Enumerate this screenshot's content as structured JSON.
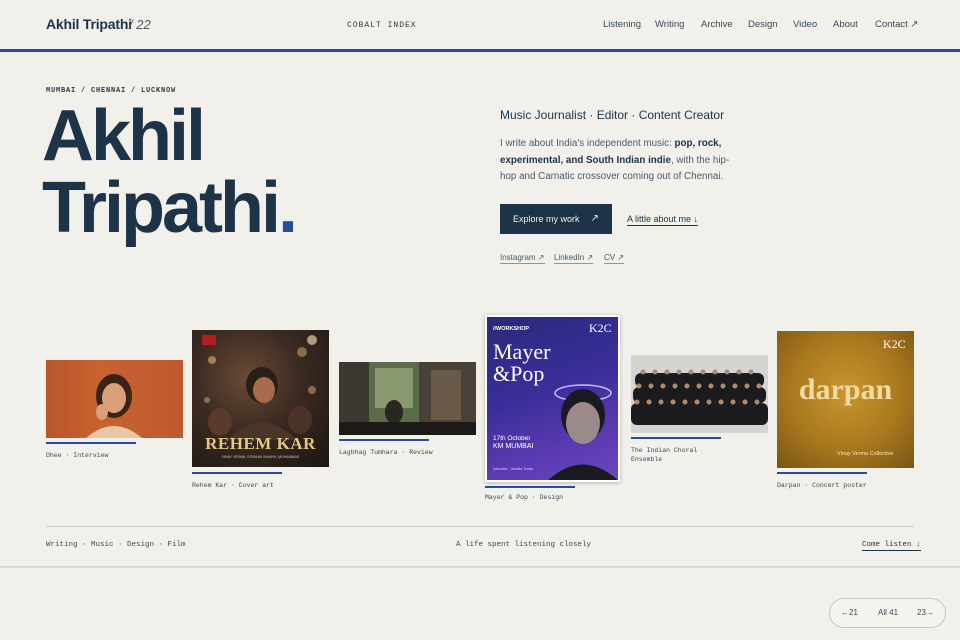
{
  "header": {
    "brand": "Akhil Tripathi",
    "brand_number": "/ 22",
    "site_name": "COBALT INDEX",
    "nav": [
      "Listening",
      "Writing",
      "Archive",
      "Design",
      "Video",
      "About",
      "Contact ↗"
    ]
  },
  "hero": {
    "locations": "MUMBAI / CHENNAI / LUCKNOW",
    "name_line1": "Akhil",
    "name_line2": "Tripathi",
    "name_dot": ".",
    "role": "Music Journalist · Editor · Content Creator",
    "bio_pre": "I write about India's independent music: ",
    "bio_bold": "pop, rock, experimental, and South Indian indie",
    "bio_post": ", with the hip-hop and Carnatic crossover coming out of Chennai.",
    "explore_label": "Explore my work",
    "explore_arrow": "↗",
    "about_label": "A little about me ↓",
    "social": [
      "Instagram ↗",
      "LinkedIn ↗",
      "CV ↗"
    ]
  },
  "gallery": [
    {
      "caption": "Dhee · Interview"
    },
    {
      "caption": "Rehem Kar · Cover art",
      "poster_text": "REHEM KAR",
      "poster_sub": "VINAY VERMA, ROSHAN SHAIKH, MOHAMMAD"
    },
    {
      "caption": "Lagbhag Tumhara · Review"
    },
    {
      "caption": "Mayer & Pop · Design",
      "tag": "//WORKSHOP",
      "logo": "K2C",
      "title": "Mayer &Pop",
      "date": "17th October",
      "place": "KM MUMBAI",
      "note": "Instructor - Vandita Tomar"
    },
    {
      "caption_line1": "The Indian Choral",
      "caption_line2": "Ensemble"
    },
    {
      "caption": "Darpan · Concert poster",
      "logo": "K2C",
      "title": "darpan",
      "sub": "Vinay Verma Collective"
    }
  ],
  "footer": {
    "left": "Writing · Music · Design · Film",
    "middle": "A life spent listening closely",
    "right": "Come listen ↓"
  },
  "pager": {
    "prev": "←21",
    "all": "All 41",
    "next": "23→"
  },
  "colors": {
    "background": "#f1f0ea",
    "ink": "#1d3348",
    "accent": "#2a4a9a"
  }
}
